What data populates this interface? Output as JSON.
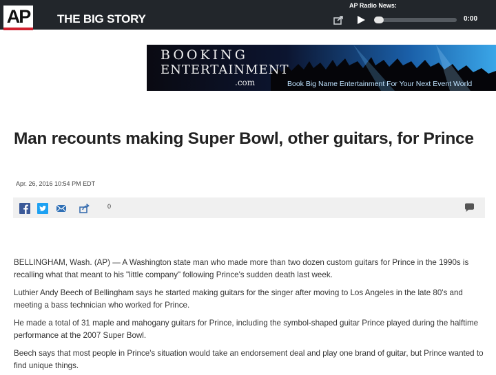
{
  "header": {
    "logo_text": "AP",
    "section_title": "THE BIG STORY",
    "radio": {
      "label": "AP Radio News:",
      "time": "0:00",
      "progress": 0
    }
  },
  "ad": {
    "brand_line1": "BOOKING",
    "brand_line2": "ENTERTAINMENT",
    "brand_line3": ".com",
    "tagline": "Book Big Name Entertainment For Your Next Event World"
  },
  "article": {
    "headline": "Man recounts making Super Bowl, other guitars, for Prince",
    "dateline": "Apr. 26, 2016 10:54 PM EDT",
    "share_count": "0",
    "paragraphs": [
      "BELLINGHAM, Wash. (AP) — A Washington state man who made more than two dozen custom guitars for Prince in the 1990s is recalling what that meant to his \"little company\" following Prince's sudden death last week.",
      "Luthier Andy Beech of Bellingham says he started making guitars for the singer after moving to Los Angeles in the late 80's and meeting a bass technician who worked for Prince.",
      "He made a total of 31 maple and mahogany guitars for Prince, including the symbol-shaped guitar Prince played during the halftime performance at the 2007 Super Bowl.",
      "Beech says that most people in Prince's situation would take an endorsement deal and play one brand of guitar, but Prince wanted to find unique things."
    ]
  },
  "colors": {
    "topbar": "#22262b",
    "ap_red": "#d0202e",
    "facebook": "#3b5998",
    "twitter": "#1da1f2",
    "email": "#2f6fb5",
    "share": "#3a6fb0"
  },
  "icons": [
    "share-icon",
    "play-icon",
    "facebook-icon",
    "twitter-icon",
    "email-icon",
    "comment-icon"
  ]
}
